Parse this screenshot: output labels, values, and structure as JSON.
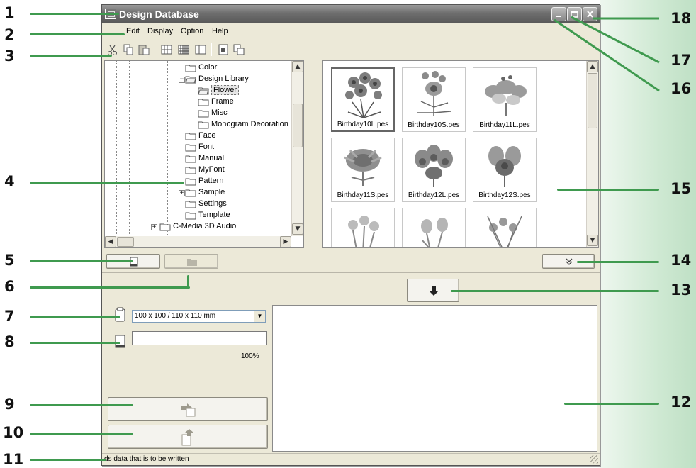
{
  "window": {
    "title": "Design Database"
  },
  "menubar": {
    "items": [
      "Edit",
      "Display",
      "Option",
      "Help"
    ]
  },
  "tree": {
    "items": [
      {
        "label": "Color"
      },
      {
        "label": "Design Library",
        "expander": "−"
      },
      {
        "label": "Flower",
        "selected": true
      },
      {
        "label": "Frame"
      },
      {
        "label": "Misc"
      },
      {
        "label": "Monogram Decoration"
      },
      {
        "label": "Face"
      },
      {
        "label": "Font"
      },
      {
        "label": "Manual"
      },
      {
        "label": "MyFont"
      },
      {
        "label": "Pattern"
      },
      {
        "label": "Sample",
        "expander": "+"
      },
      {
        "label": "Settings"
      },
      {
        "label": "Template"
      },
      {
        "label": "C-Media 3D Audio",
        "expander": "+"
      }
    ]
  },
  "thumbnails": {
    "files": [
      "Birthday10L.pes",
      "Birthday10S.pes",
      "Birthday11L.pes",
      "Birthday11S.pes",
      "Birthday12L.pes",
      "Birthday12S.pes",
      "",
      "",
      ""
    ]
  },
  "controls": {
    "hoop_size": "100 x 100 / 110 x 110 mm",
    "progress_percent_label": "100%",
    "progress_value": 0
  },
  "status": {
    "text": "ds data that is to be written"
  },
  "callouts": [
    "1",
    "2",
    "3",
    "4",
    "5",
    "6",
    "7",
    "8",
    "9",
    "10",
    "11",
    "12",
    "13",
    "14",
    "15",
    "16",
    "17",
    "18"
  ],
  "colors": {
    "leader": "#3f9a4f",
    "band": "#cfe9d3"
  }
}
